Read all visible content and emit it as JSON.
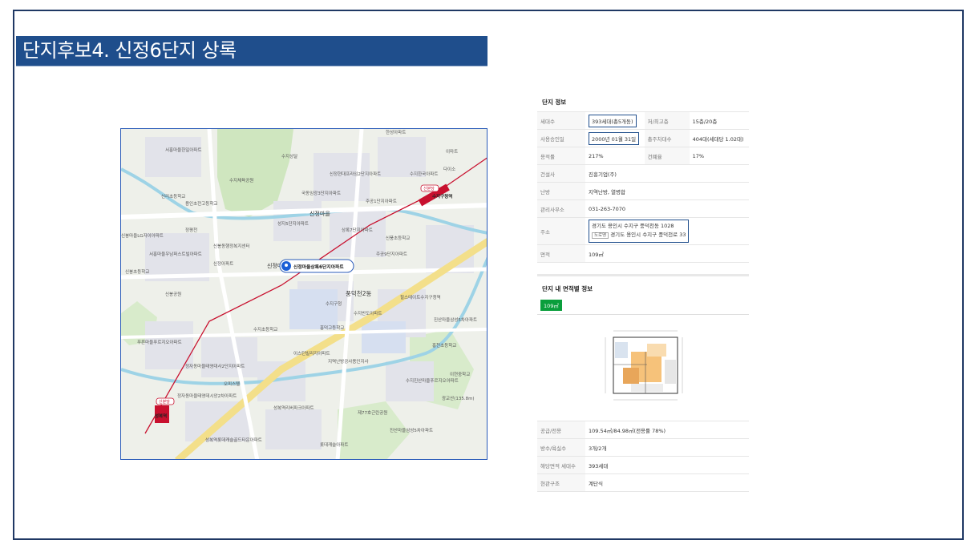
{
  "slide": {
    "title": "단지후보4. 신정6단지 상록"
  },
  "map": {
    "marker_label": "신정마을상록6단지아파트",
    "stations": [
      "신분당",
      "신분당"
    ],
    "labels": [
      "서홍마을한일아파트",
      "수지상달",
      "한성아파트",
      "신정현대프라임2단지아파트",
      "수지한국아파트",
      "다이소",
      "이마트",
      "수지체육공원",
      "국동임광3단지아파트",
      "주공1단지아파트",
      "수지구청역",
      "용인초전고등학교",
      "신리초등학교",
      "성지5단지아파트",
      "신정마을",
      "상록7단지아파트",
      "신풍초등학교",
      "정평천",
      "신봉동행정복지센터",
      "신정아파트",
      "주공9단지아파트",
      "서홍마을우남퍼스트빌아파트",
      "신봉마을LG자이아파트",
      "신정마을",
      "풍덕천2동",
      "수지구청",
      "신봉초등학교",
      "신봉공원",
      "수지초등학교",
      "홍덕고등학교",
      "수지반도아파트",
      "힐스테이트수지구청역",
      "진산마을삼성5차아파트",
      "푸른마을푸르지오아파트",
      "정자동마을태영대사2단지아파트",
      "이스턴빌리지아파트",
      "지역난방공사용인지사",
      "홍천초등학교",
      "오피스텔",
      "수지진산마을푸르지오아파트",
      "이현중학교",
      "광교산(135.8m)",
      "정자동마을태영데시앙2차아파트",
      "성복역리버파크아파트",
      "제77호근린공원",
      "진산마을삼성5차아파트",
      "성복역",
      "성복역롯데캐슬골드타운아파트",
      "롯데캐슬아파트"
    ]
  },
  "complex_info": {
    "title": "단지 정보",
    "rows": [
      {
        "l1": "세대수",
        "v1": "393세대(총5개동)",
        "v1_boxed": true,
        "l2": "저/최고층",
        "v2": "15층/20층"
      },
      {
        "l1": "사용승인일",
        "v1": "2000년 01월 31일",
        "v1_boxed": true,
        "l2": "총주차대수",
        "v2": "404대(세대당 1.02대)"
      },
      {
        "l1": "용적률",
        "v1": "217%",
        "l2": "건폐율",
        "v2": "17%"
      },
      {
        "l1": "건설사",
        "v1": "진흥기업(주)"
      },
      {
        "l1": "난방",
        "v1": "지역난방, 열병합"
      },
      {
        "l1": "관리사무소",
        "v1": "031-263-7070"
      },
      {
        "l1": "주소",
        "addr_jibun": "경기도 용인시 수지구 풍덕천동 1028",
        "addr_road_tag": "도로명",
        "addr_road": "경기도 용인시 수지구 풍덕천로 33"
      },
      {
        "l1": "면적",
        "v1": "109㎡"
      }
    ]
  },
  "area_info": {
    "title": "단지 내 면적별 정보",
    "tab": "109㎡",
    "rows": [
      {
        "label": "공급/전용",
        "value": "109.54㎡/84.98㎡(전용률 78%)"
      },
      {
        "label": "방수/욕실수",
        "value": "3개/2개"
      },
      {
        "label": "해당면적 세대수",
        "value": "393세대"
      },
      {
        "label": "현관구조",
        "value": "계단식"
      }
    ]
  },
  "colors": {
    "title_bg": "#1f4e8c",
    "frame": "#1f3864",
    "tab_green": "#0a9e3c",
    "subway": "#c8102e",
    "road_yellow": "#f3df8a",
    "park_green": "#cfe6bf",
    "water": "#9ed3e6"
  }
}
